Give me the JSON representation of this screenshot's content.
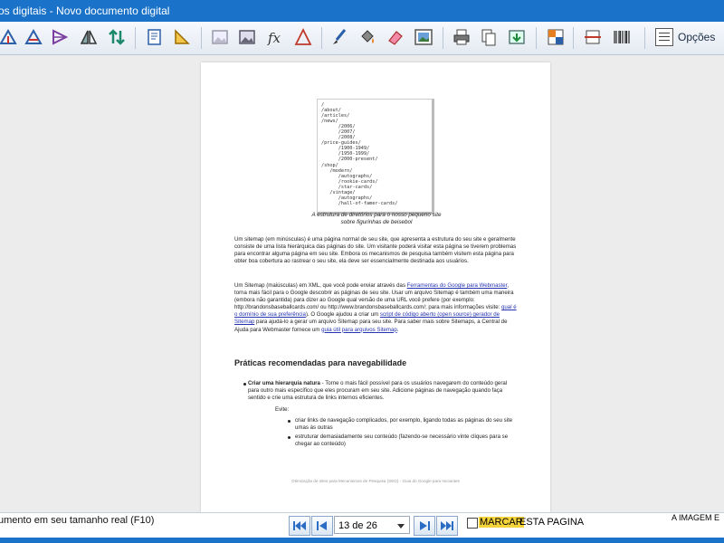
{
  "window": {
    "title": "os digitais - Novo documento digital"
  },
  "toolbar": {
    "icons": [
      "rotate-left-icon",
      "rotate-right-icon",
      "flip-icon",
      "mirror-icon",
      "swap-icon",
      "document-edit-icon",
      "ruler-icon",
      "image-light-icon",
      "image-icon",
      "formula-icon",
      "triangle-icon",
      "brush-icon",
      "fill-icon",
      "eraser-icon",
      "picture-frame-icon",
      "printer-icon",
      "copy-icon",
      "save-image-icon",
      "palette-icon",
      "cut-icon",
      "barcode-icon"
    ],
    "options_label": "Opções"
  },
  "document": {
    "directory_tree": "/\n/about/\n/articles/\n/news/\n      /2006/\n      /2007/\n      /2008/\n/price-guides/\n      /1900-1949/\n      /1950-1999/\n      /2000-present/\n/shop/\n   /modern/\n      /autographs/\n      /rookie-cards/\n      /star-cards/\n   /vintage/\n      /autographs/\n      /hall-of-famer-cards/",
    "caption": "A estrutura de diretórios para o nosso pequeno site sobre figurinhas de beisebol",
    "para1": "Um sitemap (em minúsculas) é uma página normal de seu site, que apresenta a estrutura do seu site e geralmente consiste de uma lista hierárquica das páginas do site. Um visitante poderá visitar esta página se tiverem problemas para encontrar alguma página em seu site. Embora os mecanismos de pesquisa também visitem esta página para obter boa cobertura ao rastrear o seu site, ela deve ser essencialmente destinada aos usuários.",
    "para2_a": "Um Sitemap (maiúsculas) em XML, que você pode enviar através das ",
    "para2_link1": "Ferramentas do Google para Webmaster",
    "para2_b": ", torna mais fácil para o Google descobrir as páginas de seu site. Usar um arquivo Sitemap é também uma maneira (embora não garantida) para dizer ao Google qual versão de uma URL você prefere (por exemplo: http://brandonsbaseballcards.com/ ou http://www.brandonsbaseballcards.com/; para mais informações visite: ",
    "para2_link2": "qual é o domínio de sua preferência",
    "para2_c": "). O Google ajudou a criar um ",
    "para2_link3": "script de código aberto (open source) gerador de Sitemap",
    "para2_d": " para ajudá-lo a gerar um arquivo Sitemap para seu site. Para saber mais sobre Sitemaps, a Central de Ajuda para Webmaster fornece um ",
    "para2_link4": "guia útil para arquivos Sitemap",
    "para2_e": ".",
    "heading": "Práticas recomendadas para navegabilidade",
    "bullet_bold": "Criar uma hierarquia natura",
    "bullet_text": " - Torne o mais fácil possível para os usuários navegarem do conteúdo geral para outro mais específico que eles procuram em seu site. Adicione páginas de navegação quando faça sentido e crie uma estrutura de links internos eficientes.",
    "avoid_label": "Evite:",
    "sub1": "criar links de navegação complicados, por exemplo, ligando todas as páginas do seu site umas às outras",
    "sub2": "estruturar demasiadamente seu conteúdo (fazendo-se necessário vinte cliques para se chegar ao conteúdo)",
    "footer": "Otimização de sites para Mecanismos de Pesquisa (SEO) - Guia do Google para Iniciantes"
  },
  "status": {
    "message": "umento em seu tamanho real (F10)",
    "page_indicator": "13 de 26",
    "mark_label": "MARCAR",
    "this_page_label": "ESTA PAGINA",
    "image_label": "A IMAGEM E"
  },
  "colors": {
    "titlebar": "#1b73c9",
    "link": "#2433b0",
    "highlight": "#f5d33a"
  }
}
